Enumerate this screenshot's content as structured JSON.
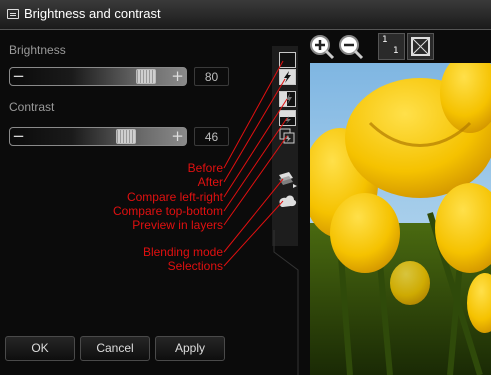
{
  "window": {
    "title": "Brightness and contrast"
  },
  "brightness": {
    "label": "Brightness",
    "value": "80",
    "level": 0.8
  },
  "contrast": {
    "label": "Contrast",
    "value": "46",
    "level": 0.65
  },
  "annotations": {
    "before": "Before",
    "after": "After",
    "compare_lr": "Compare left-right",
    "compare_tb": "Compare top-bottom",
    "preview_layers": "Preview in layers",
    "blending": "Blending mode",
    "selections": "Selections"
  },
  "buttons": {
    "ok": "OK",
    "cancel": "Cancel",
    "apply": "Apply"
  },
  "toolbar": {
    "actual_size_label": "1",
    "actual_size_sub": "1"
  },
  "colors": {
    "annotation": "#e01010",
    "accent_yellow": "#f5c400",
    "sky": "#8fc2e6"
  },
  "icons": [
    "window-icon",
    "zoom-in-icon",
    "zoom-out-icon",
    "actual-size-icon",
    "fit-to-window-icon",
    "before-icon",
    "after-icon",
    "compare-left-right-icon",
    "compare-top-bottom-icon",
    "preview-layers-icon",
    "blending-mode-icon",
    "selections-icon"
  ]
}
